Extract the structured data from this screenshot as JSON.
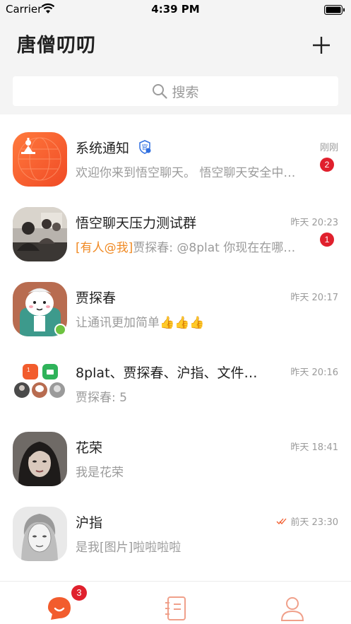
{
  "status_bar": {
    "carrier": "Carrier",
    "time": "4:39 PM"
  },
  "header": {
    "title": "唐僧叨叨",
    "search_placeholder": "搜索"
  },
  "conversations": [
    {
      "name": "系统通知",
      "preview": "欢迎你来到悟空聊天。 悟空聊天安全中…",
      "time": "刚刚",
      "unread": "2",
      "official_badge": "官",
      "avatar": "system-avatar"
    },
    {
      "name": "悟空聊天压力测试群",
      "mention": "[有人@我]",
      "preview": "贾探春: @8plat 你现在在哪…",
      "time": "昨天 20:23",
      "unread": "1",
      "avatar": "group-photo-avatar"
    },
    {
      "name": "贾探春",
      "preview": "让通讯更加简单👍👍👍",
      "time": "昨天 20:17",
      "online": true,
      "avatar": "cartoon-avatar"
    },
    {
      "name": "8plat、贾探春、沪指、文件…",
      "preview": "贾探春: 5",
      "time": "昨天 20:16",
      "avatar": "group-grid-avatar"
    },
    {
      "name": "花荣",
      "preview": "我是花荣",
      "time": "昨天 18:41",
      "avatar": "portrait-avatar"
    },
    {
      "name": "沪指",
      "preview": "是我[图片]啦啦啦啦",
      "time": "前天 23:30",
      "read_receipt": true,
      "avatar": "sketch-avatar"
    }
  ],
  "tab_bar": {
    "chats_badge": "3",
    "tabs": [
      "chat-icon",
      "contacts-icon",
      "profile-icon"
    ],
    "active_color": "#f25c2d",
    "inactive_color": "#f0a08a"
  },
  "colors": {
    "accent": "#f25c2d",
    "badge": "#e0202d",
    "mention": "#f08a24",
    "online": "#6dc240"
  }
}
